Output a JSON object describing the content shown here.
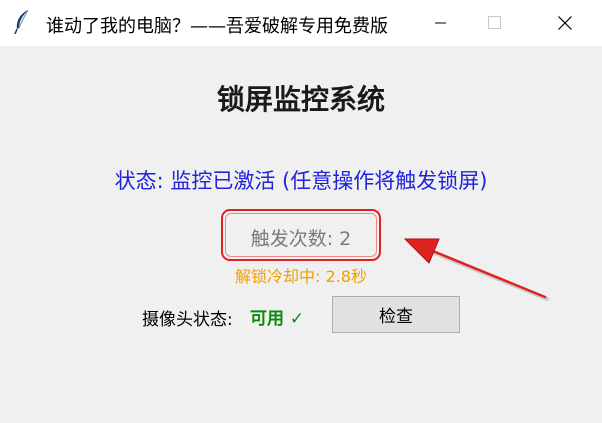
{
  "window": {
    "title": "谁动了我的电脑？——吾爱破解专用免费版",
    "app_icon": "feather-icon",
    "controls": [
      "minimize-icon",
      "maximize-icon",
      "close-icon"
    ]
  },
  "main": {
    "heading": "锁屏监控系统",
    "status": "状态: 监控已激活 (任意操作将触发锁屏)",
    "trigger_count": "触发次数: 2",
    "cooldown": "解锁冷却中: 2.8秒",
    "camera_label": "摄像头状态:",
    "camera_status": "可用 ✓",
    "check_button": "检查"
  },
  "colors": {
    "status_text": "#2222dd",
    "cooldown_text": "#f0a000",
    "camera_ok": "#0a8a0a",
    "annotation": "#dd2222"
  }
}
